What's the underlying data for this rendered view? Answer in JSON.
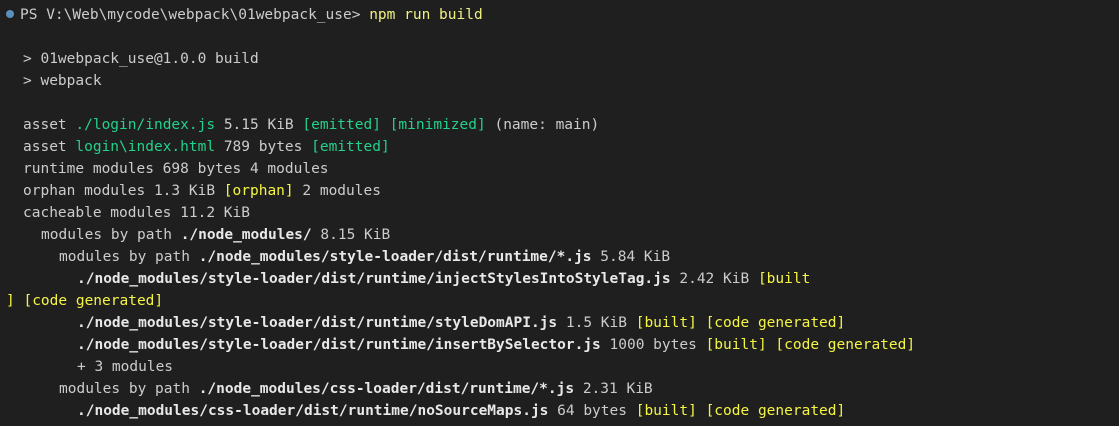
{
  "terminal": {
    "prompt": "PS V:\\Web\\mycode\\webpack\\01webpack_use>",
    "command": "npm run build",
    "script_line1": "> 01webpack_use@1.0.0 build",
    "script_line2": "> webpack",
    "asset1": {
      "label": "asset",
      "name": "./login/index.js",
      "size": "5.15 KiB",
      "tag1": "[emitted]",
      "tag2": "[minimized]",
      "suffix": "(name: main)"
    },
    "asset2": {
      "label": "asset",
      "name": "login\\index.html",
      "size": "789 bytes",
      "tag1": "[emitted]"
    },
    "runtime": "runtime modules 698 bytes 4 modules",
    "orphan": {
      "prefix": "orphan modules 1.3 KiB",
      "tag": "[orphan]",
      "suffix": "2 modules"
    },
    "cacheable": "cacheable modules 11.2 KiB",
    "nm_by_path": {
      "prefix": "modules by path",
      "path": "./node_modules/",
      "size": "8.15 KiB"
    },
    "sl_by_path": {
      "prefix": "modules by path",
      "path": "./node_modules/style-loader/dist/runtime/*.js",
      "size": "5.84 KiB"
    },
    "inject": {
      "path": "./node_modules/style-loader/dist/runtime/injectStylesIntoStyleTag.js",
      "size": "2.42 KiB",
      "tag1a": "[built",
      "tag1b": "]",
      "tag2": "[code generated]"
    },
    "styledom": {
      "path": "./node_modules/style-loader/dist/runtime/styleDomAPI.js",
      "size": "1.5 KiB",
      "tag1": "[built]",
      "tag2": "[code generated]"
    },
    "insertby": {
      "path": "./node_modules/style-loader/dist/runtime/insertBySelector.js",
      "size": "1000 bytes",
      "tag1": "[built]",
      "tag2": "[code generated]"
    },
    "more": "+ 3 modules",
    "cl_by_path": {
      "prefix": "modules by path",
      "path": "./node_modules/css-loader/dist/runtime/*.js",
      "size": "2.31 KiB"
    },
    "nosource": {
      "path": "./node_modules/css-loader/dist/runtime/noSourceMaps.js",
      "size": "64 bytes",
      "tag1": "[built]",
      "tag2": "[code generated]"
    }
  }
}
